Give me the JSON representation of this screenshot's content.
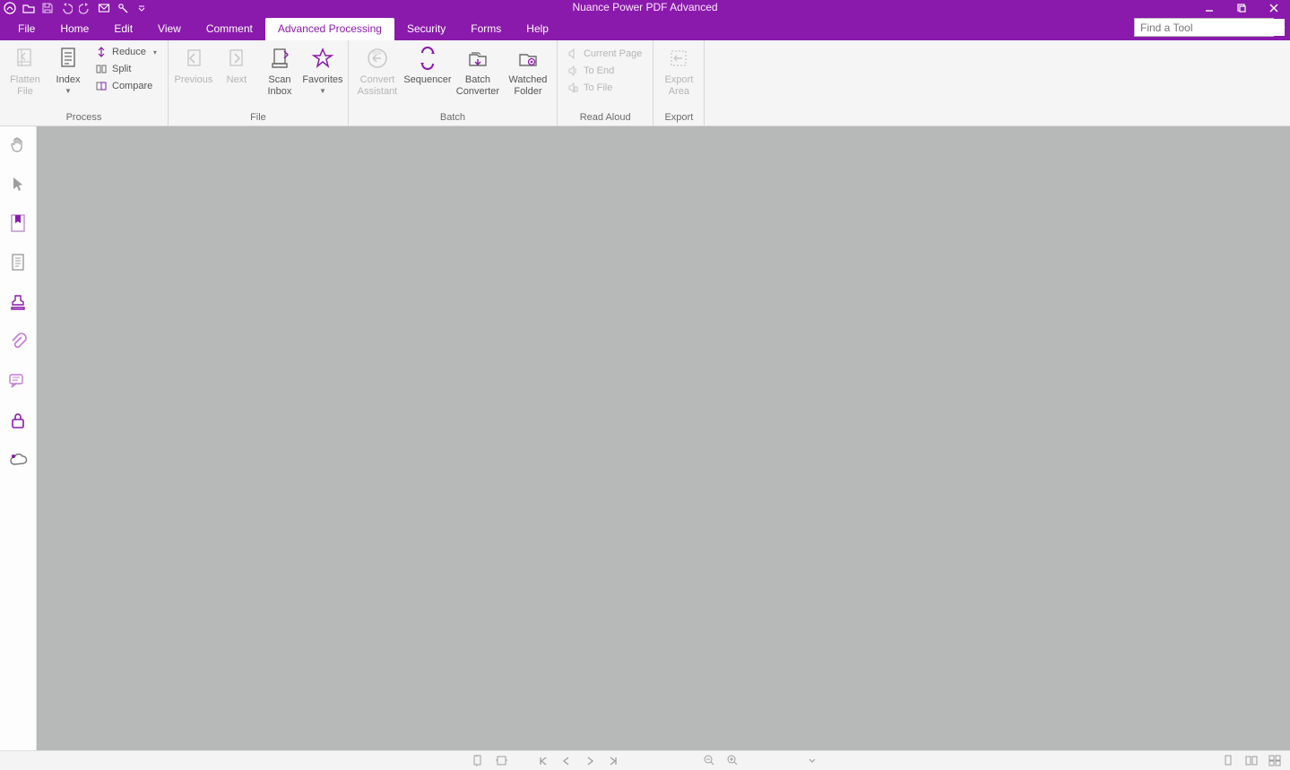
{
  "app": {
    "title": "Nuance Power PDF Advanced"
  },
  "qat_icons": [
    "app-logo-icon",
    "open-icon",
    "save-icon",
    "undo-icon",
    "redo-icon",
    "mail-icon",
    "tool-icon"
  ],
  "tabs": [
    {
      "label": "File",
      "active": false
    },
    {
      "label": "Home",
      "active": false
    },
    {
      "label": "Edit",
      "active": false
    },
    {
      "label": "View",
      "active": false
    },
    {
      "label": "Comment",
      "active": false
    },
    {
      "label": "Advanced Processing",
      "active": true
    },
    {
      "label": "Security",
      "active": false
    },
    {
      "label": "Forms",
      "active": false
    },
    {
      "label": "Help",
      "active": false
    }
  ],
  "find": {
    "placeholder": "Find a Tool"
  },
  "ribbon": {
    "groups": [
      {
        "label": "Process",
        "big": [
          {
            "name": "flatten-file",
            "line1": "Flatten",
            "line2": "File",
            "disabled": true,
            "icon": "flatten-icon"
          },
          {
            "name": "index",
            "line1": "Index",
            "line2": "",
            "dropdown": true,
            "icon": "index-icon"
          }
        ],
        "small": [
          {
            "name": "reduce",
            "label": "Reduce",
            "icon": "reduce-icon",
            "dropdown": true
          },
          {
            "name": "split",
            "label": "Split",
            "icon": "split-icon"
          },
          {
            "name": "compare",
            "label": "Compare",
            "icon": "compare-icon"
          }
        ]
      },
      {
        "label": "File",
        "big": [
          {
            "name": "previous",
            "line1": "Previous",
            "disabled": true,
            "icon": "prev-doc-icon"
          },
          {
            "name": "next",
            "line1": "Next",
            "disabled": true,
            "icon": "next-doc-icon"
          },
          {
            "name": "scan-inbox",
            "line1": "Scan",
            "line2": "Inbox",
            "icon": "scan-inbox-icon"
          },
          {
            "name": "favorites",
            "line1": "Favorites",
            "dropdown": true,
            "icon": "favorites-icon"
          }
        ]
      },
      {
        "label": "Batch",
        "big": [
          {
            "name": "convert-assistant",
            "line1": "Convert",
            "line2": "Assistant",
            "disabled": true,
            "icon": "convert-assistant-icon"
          },
          {
            "name": "sequencer",
            "line1": "Sequencer",
            "icon": "sequencer-icon"
          },
          {
            "name": "batch-converter",
            "line1": "Batch",
            "line2": "Converter",
            "icon": "batch-converter-icon"
          },
          {
            "name": "watched-folder",
            "line1": "Watched",
            "line2": "Folder",
            "icon": "watched-folder-icon"
          }
        ]
      },
      {
        "label": "Read Aloud",
        "small": [
          {
            "name": "current-page",
            "label": "Current Page",
            "icon": "speak-page-icon",
            "disabled": true
          },
          {
            "name": "to-end",
            "label": "To End",
            "icon": "speak-end-icon",
            "disabled": true
          },
          {
            "name": "to-file",
            "label": "To File",
            "icon": "speak-file-icon",
            "disabled": true
          }
        ]
      },
      {
        "label": "Export",
        "big": [
          {
            "name": "export-area",
            "line1": "Export",
            "line2": "Area",
            "disabled": true,
            "icon": "export-area-icon"
          }
        ]
      }
    ]
  },
  "left_tools": [
    {
      "name": "hand-tool-icon"
    },
    {
      "name": "select-arrow-icon"
    },
    {
      "name": "bookmarks-panel-icon"
    },
    {
      "name": "pages-panel-icon"
    },
    {
      "name": "stamp-panel-icon"
    },
    {
      "name": "attachments-panel-icon"
    },
    {
      "name": "comments-panel-icon"
    },
    {
      "name": "security-panel-icon"
    },
    {
      "name": "cloud-panel-icon"
    }
  ],
  "statusbar": {
    "center_icons": [
      "fit-page-icon",
      "fit-width-icon",
      "first-page-icon",
      "prev-page-icon",
      "next-page-icon",
      "last-page-icon"
    ],
    "zoom_icons": [
      "zoom-out-icon",
      "zoom-in-icon",
      "zoom-dropdown-icon"
    ],
    "right_icons": [
      "single-page-view-icon",
      "continuous-view-icon",
      "facing-view-icon"
    ]
  }
}
